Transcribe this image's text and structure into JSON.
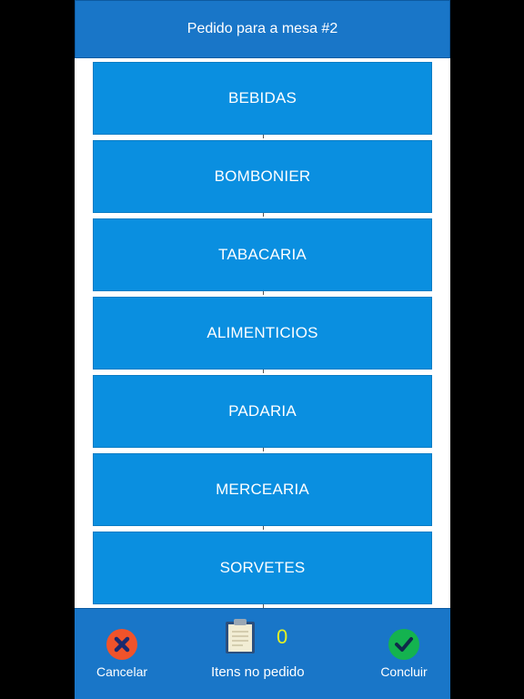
{
  "header": {
    "title": "Pedido para a mesa #2"
  },
  "categories": [
    {
      "label": "BEBIDAS"
    },
    {
      "label": "BOMBONIER"
    },
    {
      "label": "TABACARIA"
    },
    {
      "label": "ALIMENTICIOS"
    },
    {
      "label": "PADARIA"
    },
    {
      "label": "MERCEARIA"
    },
    {
      "label": "SORVETES"
    }
  ],
  "footer": {
    "cancel_label": "Cancelar",
    "item_count": "0",
    "items_label": "Itens no pedido",
    "confirm_label": "Concluir"
  },
  "colors": {
    "header_bg": "#1976c8",
    "button_bg": "#0a8fe0",
    "cancel": "#f0532a",
    "confirm": "#14b34f",
    "count_text": "#e3f024"
  },
  "icons": {
    "cancel": "close-icon",
    "order": "clipboard-icon",
    "confirm": "check-icon"
  }
}
